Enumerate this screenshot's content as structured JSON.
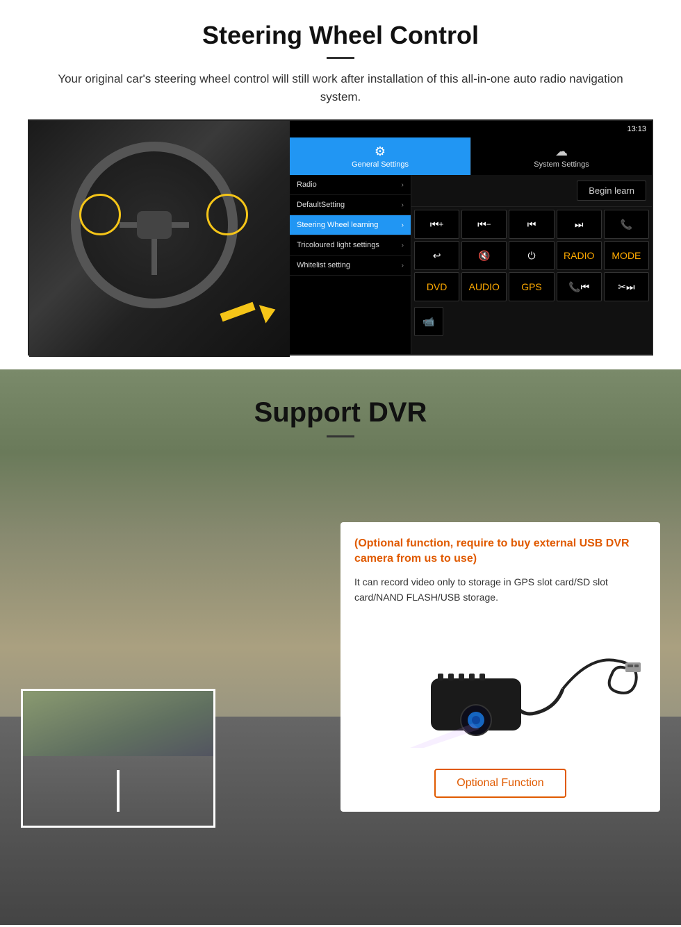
{
  "steering": {
    "title": "Steering Wheel Control",
    "description": "Your original car's steering wheel control will still work after installation of this all-in-one auto radio navigation system.",
    "statusBar": {
      "time": "13:13",
      "icons": "▾ ▾"
    },
    "tabs": {
      "general": "General Settings",
      "system": "System Settings"
    },
    "menuItems": [
      {
        "label": "Radio",
        "active": false
      },
      {
        "label": "DefaultSetting",
        "active": false
      },
      {
        "label": "Steering Wheel learning",
        "active": true
      },
      {
        "label": "Tricoloured light settings",
        "active": false
      },
      {
        "label": "Whitelist setting",
        "active": false
      }
    ],
    "beginLearnBtn": "Begin learn",
    "controlButtons": [
      "⏮+",
      "⏮-",
      "⏮⏮",
      "⏭⏭",
      "📞",
      "↩",
      "🔇",
      "⏻",
      "RADIO",
      "MODE",
      "DVD",
      "AUDIO",
      "GPS",
      "📞⏮",
      "✂⏭"
    ]
  },
  "dvr": {
    "title": "Support DVR",
    "optionalText": "(Optional function, require to buy external USB DVR camera from us to use)",
    "descText": "It can record video only to storage in GPS slot card/SD slot card/NAND FLASH/USB storage.",
    "optionalFuncBtn": "Optional Function"
  }
}
